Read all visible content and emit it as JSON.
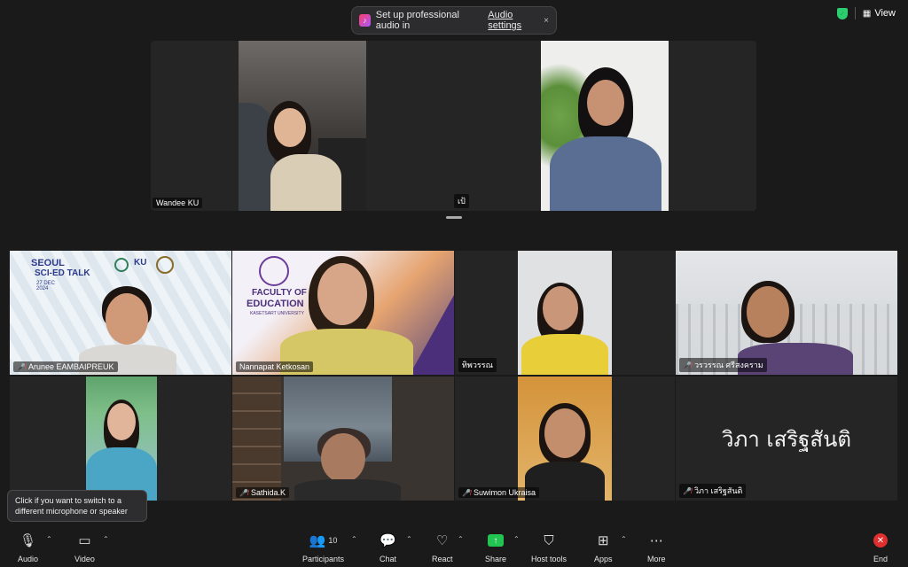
{
  "notification": {
    "text": "Set up professional audio in",
    "link": "Audio settings",
    "close": "×"
  },
  "top_right": {
    "view_label": "View"
  },
  "strip": {
    "participants": [
      {
        "name": "Wandee KU"
      },
      {
        "name": "เป้"
      }
    ]
  },
  "grid": {
    "participants": [
      {
        "name": "Arunee EAMBAIPREUK",
        "muted": true
      },
      {
        "name": "Nannapat Ketkosan",
        "muted": false
      },
      {
        "name": "ทิพวรรณ",
        "muted": false
      },
      {
        "name": "วรวรรณ ศรีสงคราม",
        "muted": true
      },
      {
        "name": "Sathida.K",
        "muted": true
      },
      {
        "name": "Suwimon Ukraisa",
        "muted": true
      },
      {
        "name": "วิภา เสริฐสันติ",
        "muted": true
      }
    ],
    "big_name": "วิภา เสริฐสันติ"
  },
  "background_text": {
    "seoul": "SEOUL",
    "sci_ed": "SCI-ED TALK",
    "date": "27 DEC 2024",
    "faculty": "FACULTY OF",
    "education": "EDUCATION",
    "university": "KASETSART UNIVERSITY",
    "ku": "KU"
  },
  "tooltip": {
    "text": "Click if you want to switch to a different microphone or speaker"
  },
  "toolbar": {
    "audio": "Audio",
    "video": "Video",
    "participants": "Participants",
    "participant_count": "10",
    "chat": "Chat",
    "react": "React",
    "share": "Share",
    "host_tools": "Host tools",
    "apps": "Apps",
    "more": "More",
    "end": "End"
  },
  "colors": {
    "background": "#1a1a1a",
    "tile": "#252525",
    "share_green": "#23c552",
    "end_red": "#e02f2f",
    "mute_red": "#ff4d4d"
  }
}
